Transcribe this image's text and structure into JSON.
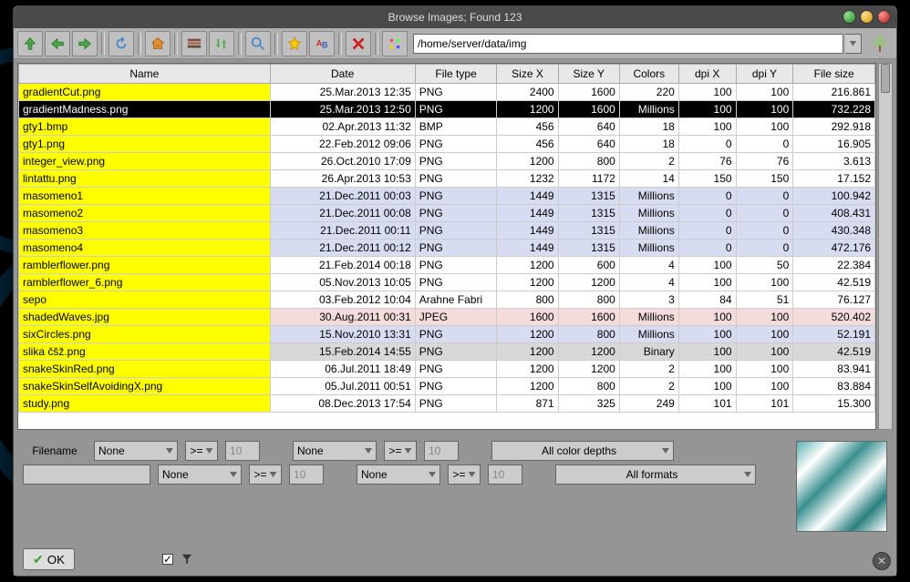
{
  "window": {
    "title": "Browse Images; Found 123"
  },
  "path": "/home/server/data/img",
  "columns": [
    "Name",
    "Date",
    "File type",
    "Size X",
    "Size Y",
    "Colors",
    "dpi X",
    "dpi Y",
    "File size"
  ],
  "rows": [
    {
      "name": "gradientCut.png",
      "date": "25.Mar.2013 12:35",
      "type": "PNG",
      "sx": "2400",
      "sy": "1600",
      "colors": "220",
      "dx": "100",
      "dy": "100",
      "size": "216.861",
      "tone": ""
    },
    {
      "name": "gradientMadness.png",
      "date": "25.Mar.2013 12:50",
      "type": "PNG",
      "sx": "1200",
      "sy": "1600",
      "colors": "Millions",
      "dx": "100",
      "dy": "100",
      "size": "732.228",
      "tone": "sel"
    },
    {
      "name": "gty1.bmp",
      "date": "02.Apr.2013 11:32",
      "type": "BMP",
      "sx": "456",
      "sy": "640",
      "colors": "18",
      "dx": "100",
      "dy": "100",
      "size": "292.918",
      "tone": ""
    },
    {
      "name": "gty1.png",
      "date": "22.Feb.2012 09:06",
      "type": "PNG",
      "sx": "456",
      "sy": "640",
      "colors": "18",
      "dx": "0",
      "dy": "0",
      "size": "16.905",
      "tone": ""
    },
    {
      "name": "integer_view.png",
      "date": "26.Oct.2010 17:09",
      "type": "PNG",
      "sx": "1200",
      "sy": "800",
      "colors": "2",
      "dx": "76",
      "dy": "76",
      "size": "3.613",
      "tone": ""
    },
    {
      "name": "lintattu.png",
      "date": "26.Apr.2013 10:53",
      "type": "PNG",
      "sx": "1232",
      "sy": "1172",
      "colors": "14",
      "dx": "150",
      "dy": "150",
      "size": "17.152",
      "tone": ""
    },
    {
      "name": "masomeno1",
      "date": "21.Dec.2011 00:03",
      "type": "PNG",
      "sx": "1449",
      "sy": "1315",
      "colors": "Millions",
      "dx": "0",
      "dy": "0",
      "size": "100.942",
      "tone": "blue"
    },
    {
      "name": "masomeno2",
      "date": "21.Dec.2011 00:08",
      "type": "PNG",
      "sx": "1449",
      "sy": "1315",
      "colors": "Millions",
      "dx": "0",
      "dy": "0",
      "size": "408.431",
      "tone": "blue"
    },
    {
      "name": "masomeno3",
      "date": "21.Dec.2011 00:11",
      "type": "PNG",
      "sx": "1449",
      "sy": "1315",
      "colors": "Millions",
      "dx": "0",
      "dy": "0",
      "size": "430.348",
      "tone": "blue"
    },
    {
      "name": "masomeno4",
      "date": "21.Dec.2011 00:12",
      "type": "PNG",
      "sx": "1449",
      "sy": "1315",
      "colors": "Millions",
      "dx": "0",
      "dy": "0",
      "size": "472.176",
      "tone": "blue"
    },
    {
      "name": "ramblerflower.png",
      "date": "21.Feb.2014 00:18",
      "type": "PNG",
      "sx": "1200",
      "sy": "600",
      "colors": "4",
      "dx": "100",
      "dy": "50",
      "size": "22.384",
      "tone": ""
    },
    {
      "name": "ramblerflower_6.png",
      "date": "05.Nov.2013 10:05",
      "type": "PNG",
      "sx": "1200",
      "sy": "1200",
      "colors": "4",
      "dx": "100",
      "dy": "100",
      "size": "42.519",
      "tone": ""
    },
    {
      "name": "sepo",
      "date": "03.Feb.2012 10:04",
      "type": "Arahne Fabri",
      "sx": "800",
      "sy": "800",
      "colors": "3",
      "dx": "84",
      "dy": "51",
      "size": "76.127",
      "tone": ""
    },
    {
      "name": "shadedWaves.jpg",
      "date": "30.Aug.2011 00:31",
      "type": "JPEG",
      "sx": "1600",
      "sy": "1600",
      "colors": "Millions",
      "dx": "100",
      "dy": "100",
      "size": "520.402",
      "tone": "pink"
    },
    {
      "name": "sixCircles.png",
      "date": "15.Nov.2010 13:31",
      "type": "PNG",
      "sx": "1200",
      "sy": "800",
      "colors": "Millions",
      "dx": "100",
      "dy": "100",
      "size": "52.191",
      "tone": "blue"
    },
    {
      "name": "slika čšž.png",
      "date": "15.Feb.2014 14:55",
      "type": "PNG",
      "sx": "1200",
      "sy": "1200",
      "colors": "Binary",
      "dx": "100",
      "dy": "100",
      "size": "42.519",
      "tone": "gray"
    },
    {
      "name": "snakeSkinRed.png",
      "date": "06.Jul.2011 18:49",
      "type": "PNG",
      "sx": "1200",
      "sy": "1200",
      "colors": "2",
      "dx": "100",
      "dy": "100",
      "size": "83.941",
      "tone": ""
    },
    {
      "name": "snakeSkinSelfAvoidingX.png",
      "date": "05.Jul.2011 00:51",
      "type": "PNG",
      "sx": "1200",
      "sy": "800",
      "colors": "2",
      "dx": "100",
      "dy": "100",
      "size": "83.884",
      "tone": ""
    },
    {
      "name": "study.png",
      "date": "08.Dec.2013 17:54",
      "type": "PNG",
      "sx": "871",
      "sy": "325",
      "colors": "249",
      "dx": "101",
      "dy": "101",
      "size": "15.300",
      "tone": ""
    }
  ],
  "filter": {
    "filename_label": "Filename",
    "none": "None",
    "cmp": ">=",
    "ten": "10",
    "all_depths": "All color depths",
    "all_formats": "All formats"
  },
  "ok_label": "OK"
}
